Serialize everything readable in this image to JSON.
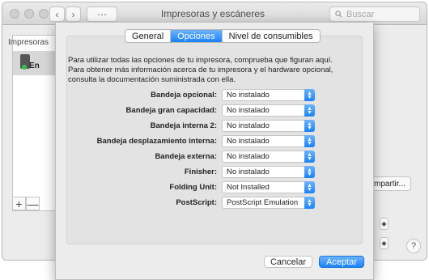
{
  "window": {
    "title": "Impresoras y escáneres",
    "search_placeholder": "Buscar",
    "nav_back": "‹",
    "nav_forward": "›",
    "grid": "⋯"
  },
  "printers": {
    "label": "Impresoras",
    "items": [
      {
        "name": "En"
      }
    ],
    "add": "+",
    "remove": "—"
  },
  "back_panel": {
    "share_button": "mpartir...",
    "help": "?"
  },
  "sheet": {
    "tabs": [
      {
        "label": "General",
        "active": false
      },
      {
        "label": "Opciones",
        "active": true
      },
      {
        "label": "Nivel de consumibles",
        "active": false
      }
    ],
    "intro": "Para utilizar todas las opciones de tu impresora, comprueba que figuran aquí. Para obtener más información acerca de tu impresora y el hardware opcional, consulta la documentación suministrada con ella.",
    "options": [
      {
        "label": "Bandeja opcional:",
        "value": "No instalado"
      },
      {
        "label": "Bandeja gran capacidad:",
        "value": "No instalado"
      },
      {
        "label": "Bandeja interna 2:",
        "value": "No instalado"
      },
      {
        "label": "Bandeja desplazamiento interna:",
        "value": "No instalado"
      },
      {
        "label": "Bandeja externa:",
        "value": "No instalado"
      },
      {
        "label": "Finisher:",
        "value": "No instalado"
      },
      {
        "label": "Folding Unit:",
        "value": "Not Installed"
      },
      {
        "label": "PostScript:",
        "value": "PostScript Emulation"
      }
    ],
    "cancel": "Cancelar",
    "accept": "Aceptar"
  },
  "colors": {
    "accent": "#1a82fb"
  }
}
